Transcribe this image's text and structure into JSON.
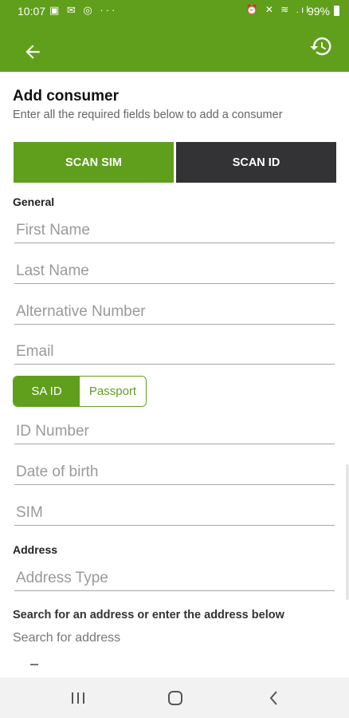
{
  "status_bar": {
    "time": "10:07",
    "left_icons": "▣ ✉ ◎  ···",
    "right_icons": "⏰ ✕ ≋ .ıl",
    "battery": "99%"
  },
  "header": {
    "back_icon": "arrow-left-icon",
    "history_icon": "history-icon",
    "color": "#5f9f1c"
  },
  "page": {
    "title": "Add consumer",
    "subtitle": "Enter all the required fields below to add a consumer"
  },
  "scan_buttons": {
    "sim": "SCAN SIM",
    "id": "SCAN ID"
  },
  "general": {
    "heading": "General",
    "first_name": "First Name",
    "last_name": "Last Name",
    "alt_number": "Alternative Number",
    "email": "Email"
  },
  "id_type": {
    "options": [
      "SA ID",
      "Passport"
    ],
    "selected": "SA ID"
  },
  "identity": {
    "id_number": "ID Number",
    "dob": "Date of birth",
    "sim": "SIM"
  },
  "address": {
    "heading": "Address",
    "type": "Address Type",
    "search_heading": "Search for an address or enter the address below",
    "search_label": "Search for address"
  },
  "nav": {
    "recent_icon": "recent-apps-icon",
    "home_icon": "home-icon",
    "back_icon": "nav-back-icon"
  }
}
